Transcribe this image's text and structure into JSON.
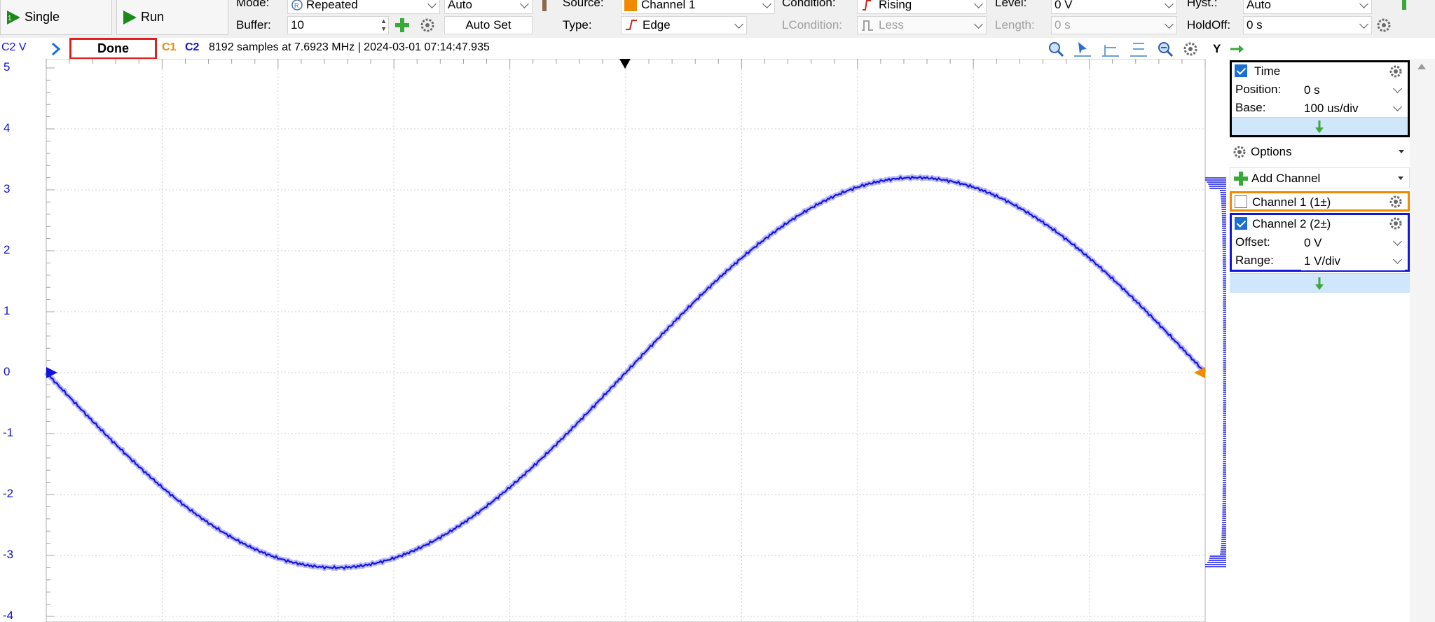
{
  "toolbar": {
    "single_label": "Single",
    "run_label": "Run",
    "mode_label": "Mode:",
    "mode_value": "Repeated",
    "auto_value": "Auto",
    "buffer_label": "Buffer:",
    "buffer_value": "10",
    "autoset_label": "Auto Set",
    "source_label": "Source:",
    "source_value": "Channel 1",
    "type_label": "Type:",
    "type_value": "Edge",
    "condition_label": "Condition:",
    "condition_value": "Rising",
    "lcondition_label": "LCondition:",
    "lcondition_value": "Less",
    "level_label": "Level:",
    "level_value": "0 V",
    "length_label": "Length:",
    "length_value": "0 s",
    "hyst_label": "Hyst.:",
    "hyst_value": "Auto",
    "holdoff_label": "HoldOff:",
    "holdoff_value": "0 s"
  },
  "status": {
    "channel_unit": "C2 V",
    "state": "Done",
    "c1": "C1",
    "c2": "C2",
    "info": "8192 samples at 7.6923 MHz | 2024-03-01 07:14:47.935",
    "y_button": "Y"
  },
  "axis": {
    "y_ticks": [
      "5",
      "4",
      "3",
      "2",
      "1",
      "0",
      "-1",
      "-2",
      "-3",
      "-4"
    ]
  },
  "panel": {
    "time_title": "Time",
    "position_label": "Position:",
    "position_value": "0 s",
    "base_label": "Base:",
    "base_value": "100 us/div",
    "options_label": "Options",
    "add_channel_label": "Add Channel",
    "channel1_label": "Channel 1 (1±)",
    "channel2_label": "Channel 2 (2±)",
    "offset_label": "Offset:",
    "offset_value": "0 V",
    "range_label": "Range:",
    "range_value": "1 V/div"
  },
  "colors": {
    "channel1": "#f08a00",
    "channel2": "#1414e0",
    "done_border": "#e02020"
  },
  "signal": {
    "amplitude_v": 3.2,
    "cycles_visible": 1,
    "phase": "inverted-sine"
  }
}
